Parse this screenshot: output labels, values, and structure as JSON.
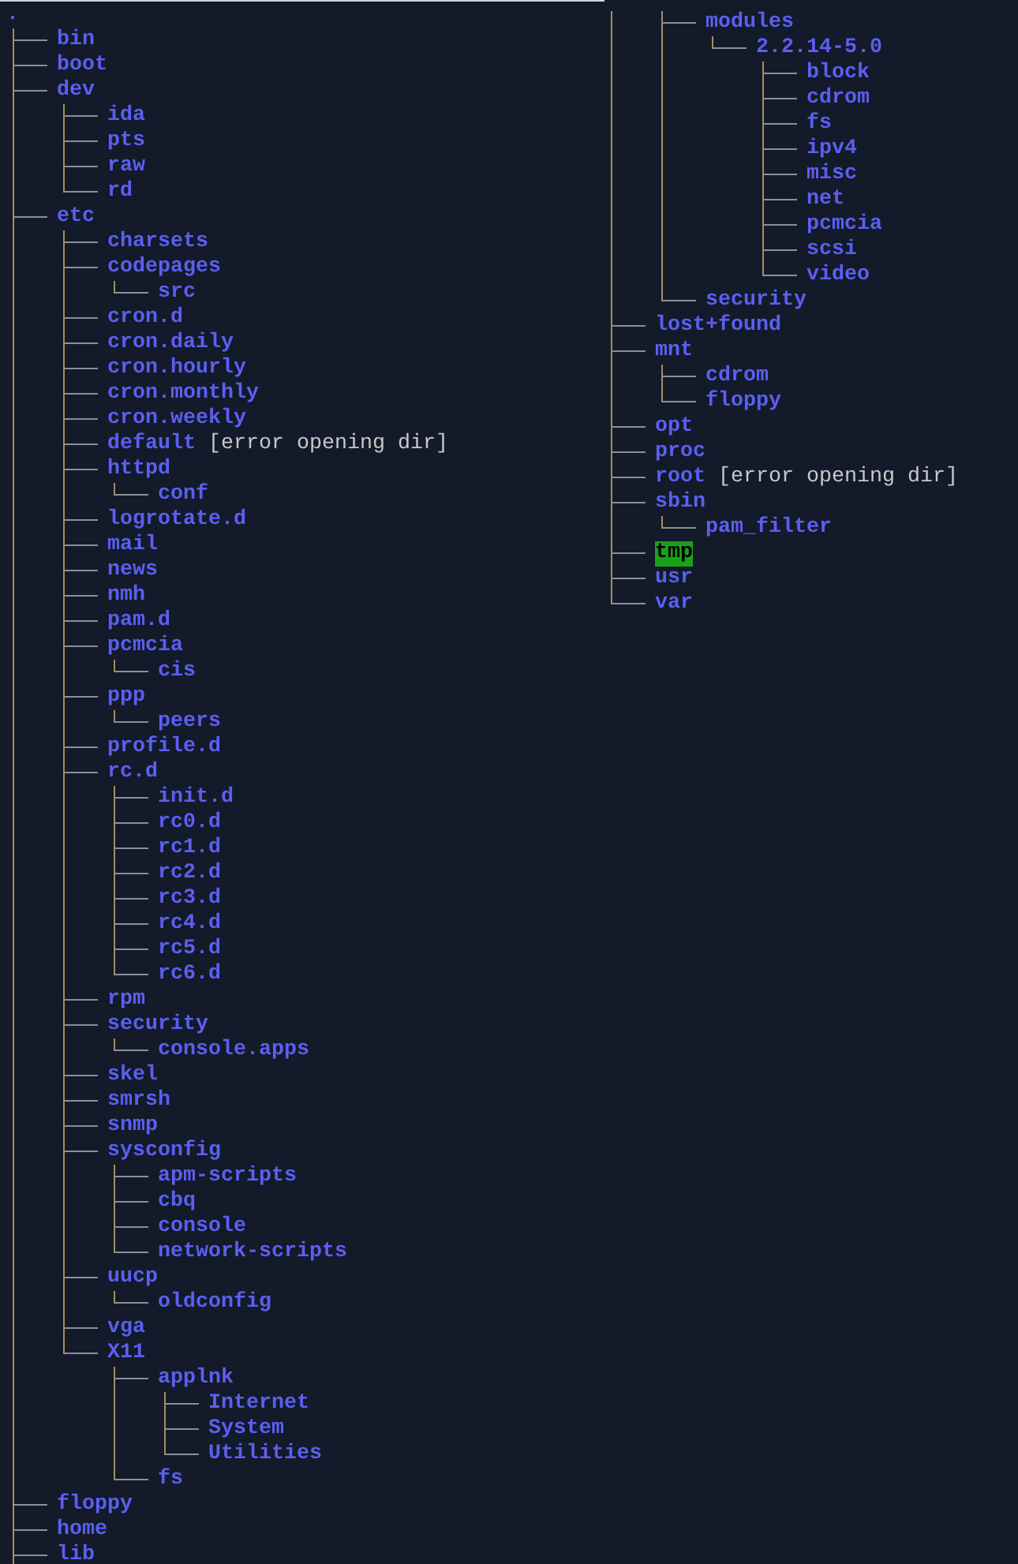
{
  "left_pane": {
    "root": ".",
    "continues": true,
    "children": [
      {
        "name": "bin"
      },
      {
        "name": "boot"
      },
      {
        "name": "dev",
        "children": [
          {
            "name": "ida"
          },
          {
            "name": "pts"
          },
          {
            "name": "raw"
          },
          {
            "name": "rd"
          }
        ]
      },
      {
        "name": "etc",
        "children": [
          {
            "name": "charsets"
          },
          {
            "name": "codepages",
            "children": [
              {
                "name": "src"
              }
            ]
          },
          {
            "name": "cron.d"
          },
          {
            "name": "cron.daily"
          },
          {
            "name": "cron.hourly"
          },
          {
            "name": "cron.monthly"
          },
          {
            "name": "cron.weekly"
          },
          {
            "name": "default",
            "note": "[error opening dir]"
          },
          {
            "name": "httpd",
            "children": [
              {
                "name": "conf"
              }
            ]
          },
          {
            "name": "logrotate.d"
          },
          {
            "name": "mail"
          },
          {
            "name": "news"
          },
          {
            "name": "nmh"
          },
          {
            "name": "pam.d"
          },
          {
            "name": "pcmcia",
            "children": [
              {
                "name": "cis"
              }
            ]
          },
          {
            "name": "ppp",
            "children": [
              {
                "name": "peers"
              }
            ]
          },
          {
            "name": "profile.d"
          },
          {
            "name": "rc.d",
            "children": [
              {
                "name": "init.d"
              },
              {
                "name": "rc0.d"
              },
              {
                "name": "rc1.d"
              },
              {
                "name": "rc2.d"
              },
              {
                "name": "rc3.d"
              },
              {
                "name": "rc4.d"
              },
              {
                "name": "rc5.d"
              },
              {
                "name": "rc6.d"
              }
            ]
          },
          {
            "name": "rpm"
          },
          {
            "name": "security",
            "children": [
              {
                "name": "console.apps"
              }
            ]
          },
          {
            "name": "skel"
          },
          {
            "name": "smrsh"
          },
          {
            "name": "snmp"
          },
          {
            "name": "sysconfig",
            "children": [
              {
                "name": "apm-scripts"
              },
              {
                "name": "cbq"
              },
              {
                "name": "console"
              },
              {
                "name": "network-scripts"
              }
            ]
          },
          {
            "name": "uucp",
            "children": [
              {
                "name": "oldconfig"
              }
            ]
          },
          {
            "name": "vga"
          },
          {
            "name": "X11",
            "children": [
              {
                "name": "applnk",
                "children": [
                  {
                    "name": "Internet"
                  },
                  {
                    "name": "System"
                  },
                  {
                    "name": "Utilities"
                  }
                ]
              },
              {
                "name": "fs"
              }
            ]
          }
        ]
      },
      {
        "name": "floppy"
      },
      {
        "name": "home"
      },
      {
        "name": "lib"
      }
    ]
  },
  "right_pane": {
    "continued_parent": {
      "children": [
        {
          "name": "modules",
          "children": [
            {
              "name": "2.2.14-5.0",
              "children": [
                {
                  "name": "block"
                },
                {
                  "name": "cdrom"
                },
                {
                  "name": "fs"
                },
                {
                  "name": "ipv4"
                },
                {
                  "name": "misc"
                },
                {
                  "name": "net"
                },
                {
                  "name": "pcmcia"
                },
                {
                  "name": "scsi"
                },
                {
                  "name": "video"
                }
              ]
            }
          ]
        },
        {
          "name": "security"
        }
      ]
    },
    "items": [
      {
        "name": "lost+found",
        "highlighted": false
      },
      {
        "name": "mnt",
        "highlighted": false,
        "children": [
          {
            "name": "cdrom"
          },
          {
            "name": "floppy"
          }
        ]
      },
      {
        "name": "opt",
        "highlighted": false
      },
      {
        "name": "proc",
        "highlighted": false
      },
      {
        "name": "root",
        "highlighted": false,
        "note": "[error opening dir]"
      },
      {
        "name": "sbin",
        "highlighted": false,
        "children": [
          {
            "name": "pam_filter"
          }
        ]
      },
      {
        "name": "tmp",
        "highlighted": true
      },
      {
        "name": "usr",
        "highlighted": false
      },
      {
        "name": "var",
        "highlighted": false
      }
    ]
  }
}
